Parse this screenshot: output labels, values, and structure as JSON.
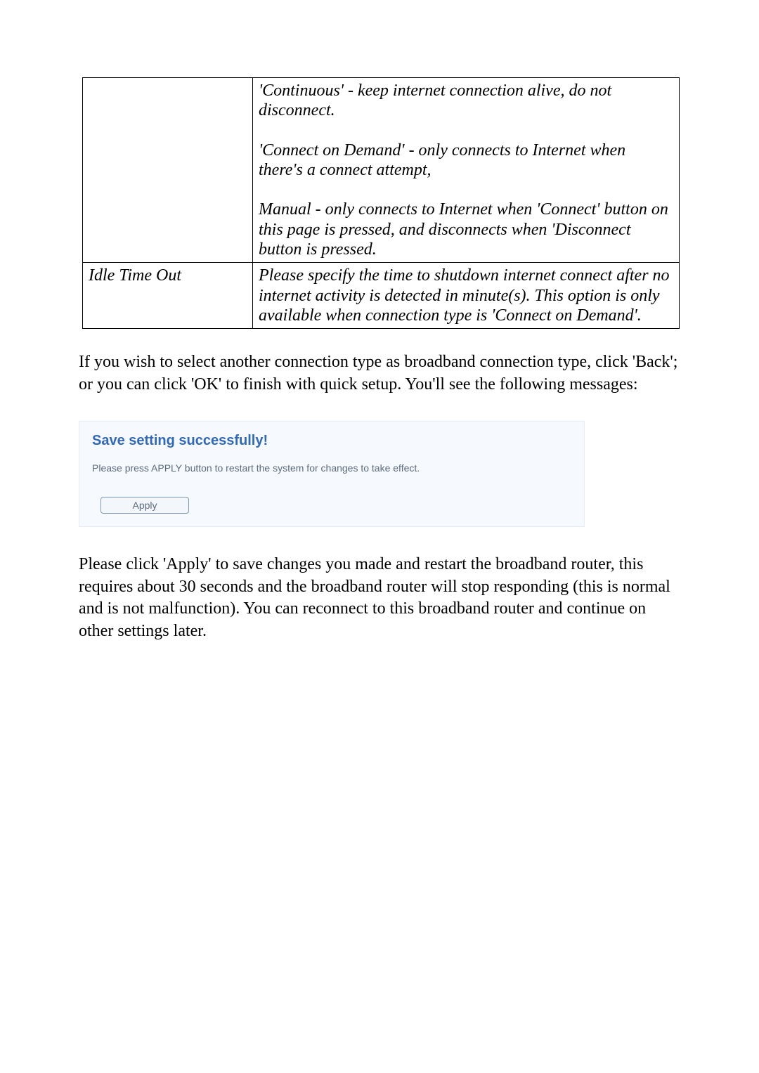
{
  "table": {
    "row1": {
      "label": "",
      "col2_p1": "'Continuous' - keep internet connection alive, do not disconnect.",
      "col2_p2": "'Connect on Demand' - only connects to Internet when there's a connect attempt,",
      "col2_p3": "Manual - only connects to Internet when 'Connect' button on this page is pressed, and disconnects when 'Disconnect button is pressed."
    },
    "row2": {
      "label": "Idle Time Out",
      "col2": "Please specify the time to shutdown internet connect after no internet activity is detected in minute(s). This option is only available when connection type is 'Connect on Demand'."
    }
  },
  "para1": "If you wish to select another connection type as broadband connection type, click 'Back'; or you can click 'OK' to finish with quick setup. You'll see the following messages:",
  "panel": {
    "title": "Save setting successfully!",
    "message": "Please press APPLY button to restart the system for changes to take effect.",
    "button": "Apply"
  },
  "para2": "Please click 'Apply' to save changes you made and restart the broadband router, this requires about 30 seconds and the broadband router will stop responding (this is normal and is not malfunction). You can reconnect to this broadband router and continue on other settings later."
}
